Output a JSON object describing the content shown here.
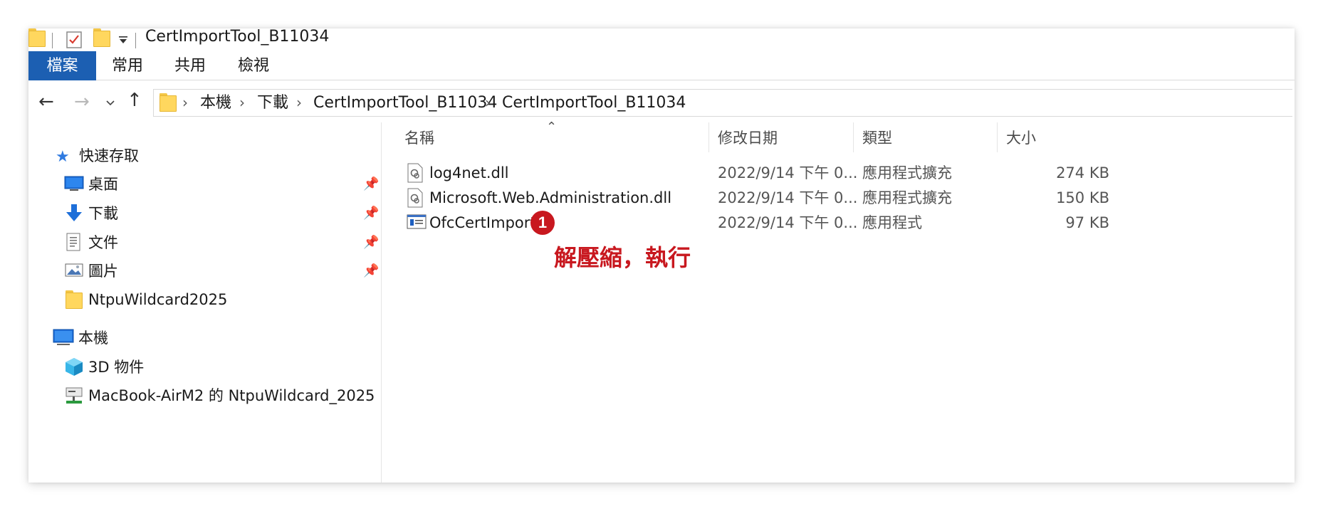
{
  "window": {
    "title": "CertImportTool_B11034"
  },
  "ribbon": {
    "tabs": [
      {
        "label": "檔案",
        "active": true
      },
      {
        "label": "常用",
        "active": false
      },
      {
        "label": "共用",
        "active": false
      },
      {
        "label": "檢視",
        "active": false
      }
    ]
  },
  "address_bar": {
    "breadcrumbs": [
      "本機",
      "下載",
      "CertImportTool_B11034",
      "CertImportTool_B11034"
    ]
  },
  "nav_pane": {
    "quick_access": {
      "label": "快速存取",
      "items": [
        {
          "label": "桌面",
          "icon": "desktop-icon",
          "pinned": true
        },
        {
          "label": "下載",
          "icon": "download-icon",
          "pinned": true
        },
        {
          "label": "文件",
          "icon": "documents-icon",
          "pinned": true
        },
        {
          "label": "圖片",
          "icon": "pictures-icon",
          "pinned": true
        },
        {
          "label": "NtpuWildcard2025",
          "icon": "folder-icon",
          "pinned": false
        }
      ]
    },
    "this_pc": {
      "label": "本機",
      "items": [
        {
          "label": "3D 物件",
          "icon": "3d-objects-icon"
        },
        {
          "label": "MacBook-AirM2 的 NtpuWildcard_2025",
          "icon": "network-drive-icon"
        }
      ]
    }
  },
  "file_list": {
    "columns": [
      "名稱",
      "修改日期",
      "類型",
      "大小"
    ],
    "rows": [
      {
        "name": "log4net.dll",
        "date": "2022/9/14 下午 0...",
        "type": "應用程式擴充",
        "size": "274 KB",
        "icon": "dll-file-icon"
      },
      {
        "name": "Microsoft.Web.Administration.dll",
        "date": "2022/9/14 下午 0...",
        "type": "應用程式擴充",
        "size": "150 KB",
        "icon": "dll-file-icon"
      },
      {
        "name": "OfcCertImport",
        "date": "2022/9/14 下午 0...",
        "type": "應用程式",
        "size": "97 KB",
        "icon": "exe-file-icon"
      }
    ]
  },
  "annotation": {
    "step_number": "1",
    "text": "解壓縮，執行",
    "color": "#c8181f"
  },
  "colors": {
    "ribbon_active": "#1c5fb2",
    "folder": "#ffd75e"
  }
}
